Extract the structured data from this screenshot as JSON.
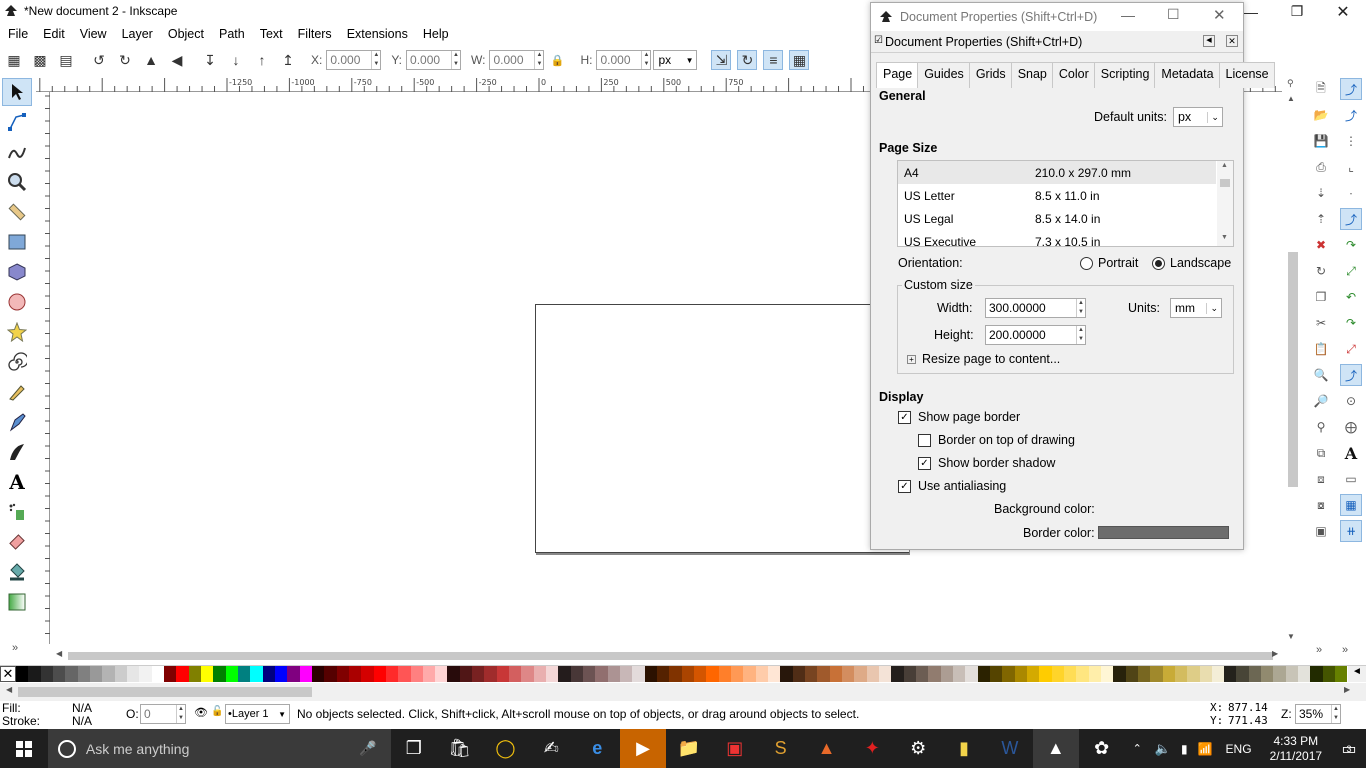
{
  "window": {
    "title": "*New document 2 - Inkscape"
  },
  "menu": [
    "File",
    "Edit",
    "View",
    "Layer",
    "Object",
    "Path",
    "Text",
    "Filters",
    "Extensions",
    "Help"
  ],
  "toolbar": {
    "x_label": "X:",
    "x_value": "0.000",
    "y_label": "Y:",
    "y_value": "0.000",
    "w_label": "W:",
    "w_value": "0.000",
    "h_label": "H:",
    "h_value": "0.000",
    "unit": "px"
  },
  "ruler": {
    "top_ticks": [
      "-1250",
      "-1000",
      "-750",
      "-500",
      "-250",
      "0",
      "250",
      "500",
      "750"
    ]
  },
  "dialog": {
    "window_title": "Document Properties (Shift+Ctrl+D)",
    "header_title": "Document Properties (Shift+Ctrl+D)",
    "tabs": [
      "Page",
      "Guides",
      "Grids",
      "Snap",
      "Color",
      "Scripting",
      "Metadata",
      "License"
    ],
    "general_heading": "General",
    "default_units_label": "Default units:",
    "default_units_value": "px",
    "page_size_heading": "Page Size",
    "page_sizes": [
      {
        "name": "A4",
        "size": "210.0 x 297.0 mm"
      },
      {
        "name": "US Letter",
        "size": "8.5 x 11.0 in"
      },
      {
        "name": "US Legal",
        "size": "8.5 x 14.0 in"
      },
      {
        "name": "US Executive",
        "size": "7.3 x 10.5 in"
      }
    ],
    "orientation_label": "Orientation:",
    "portrait_label": "Portrait",
    "landscape_label": "Landscape",
    "custom_size_label": "Custom size",
    "width_label": "Width:",
    "width_value": "300.00000",
    "height_label": "Height:",
    "height_value": "200.00000",
    "units_label": "Units:",
    "units_value": "mm",
    "resize_label": "Resize page to content...",
    "display_heading": "Display",
    "show_page_border": "Show page border",
    "border_on_top": "Border on top of drawing",
    "show_border_shadow": "Show border shadow",
    "use_antialiasing": "Use antialiasing",
    "background_color_label": "Background color:",
    "border_color_label": "Border color:",
    "border_color": "#6d6d6d"
  },
  "status": {
    "fill_label": "Fill:",
    "fill_value": "N/A",
    "stroke_label": "Stroke:",
    "stroke_value": "N/A",
    "opacity_label": "O:",
    "opacity_value": "0",
    "layer": "•Layer 1",
    "message": "No objects selected. Click, Shift+click, Alt+scroll mouse on top of objects, or drag around objects to select.",
    "x_label": "X:",
    "x_value": "877.14",
    "y_label": "Y:",
    "y_value": "771.43",
    "z_label": "Z:",
    "zoom": "35%"
  },
  "taskbar": {
    "search_placeholder": "Ask me anything",
    "language": "ENG",
    "time": "4:33 PM",
    "date": "2/11/2017",
    "notifications": "3"
  },
  "palette": [
    "#000000",
    "#1a1a1a",
    "#333333",
    "#4d4d4d",
    "#666666",
    "#808080",
    "#999999",
    "#b3b3b3",
    "#cccccc",
    "#e6e6e6",
    "#f2f2f2",
    "#ffffff",
    "#800000",
    "#ff0000",
    "#808000",
    "#ffff00",
    "#008000",
    "#00ff00",
    "#008080",
    "#00ffff",
    "#000080",
    "#0000ff",
    "#800080",
    "#ff00ff",
    "#2b0000",
    "#550000",
    "#800000",
    "#aa0000",
    "#d40000",
    "#ff0000",
    "#ff2a2a",
    "#ff5555",
    "#ff8080",
    "#ffaaaa",
    "#ffd5d5",
    "#280b0b",
    "#501616",
    "#782121",
    "#a02c2c",
    "#c83737",
    "#d35f5f",
    "#de8787",
    "#e9afaf",
    "#f4d7d7",
    "#241c1c",
    "#483737",
    "#6c5353",
    "#916f6f",
    "#ac9393",
    "#c8b7b7",
    "#e3dbdb",
    "#2b1100",
    "#552200",
    "#803300",
    "#aa4400",
    "#d45500",
    "#ff6600",
    "#ff7f2a",
    "#ff9955",
    "#ffb380",
    "#ffccaa",
    "#ffe6d5",
    "#28170b",
    "#502d16",
    "#784421",
    "#a05a2c",
    "#c87137",
    "#d38d5f",
    "#deaa87",
    "#e9c6af",
    "#f4e3d7",
    "#241f1c",
    "#483e37",
    "#6c5d53",
    "#917c6f",
    "#ac9d93",
    "#c8beb7",
    "#e3dedb",
    "#2b2200",
    "#554400",
    "#806600",
    "#aa8800",
    "#d4aa00",
    "#ffcc00",
    "#ffd42a",
    "#ffdd55",
    "#ffe680",
    "#ffeeaa",
    "#fff6d5",
    "#28220b",
    "#504416",
    "#786721",
    "#a0892c",
    "#c8ab37",
    "#d3bc5f",
    "#decd87",
    "#e9ddaf",
    "#f4eed7",
    "#24221c",
    "#484537",
    "#6c6753",
    "#918a6f",
    "#aca793",
    "#c8c4b7",
    "#e3e2db",
    "#222b00",
    "#445500",
    "#668000"
  ]
}
